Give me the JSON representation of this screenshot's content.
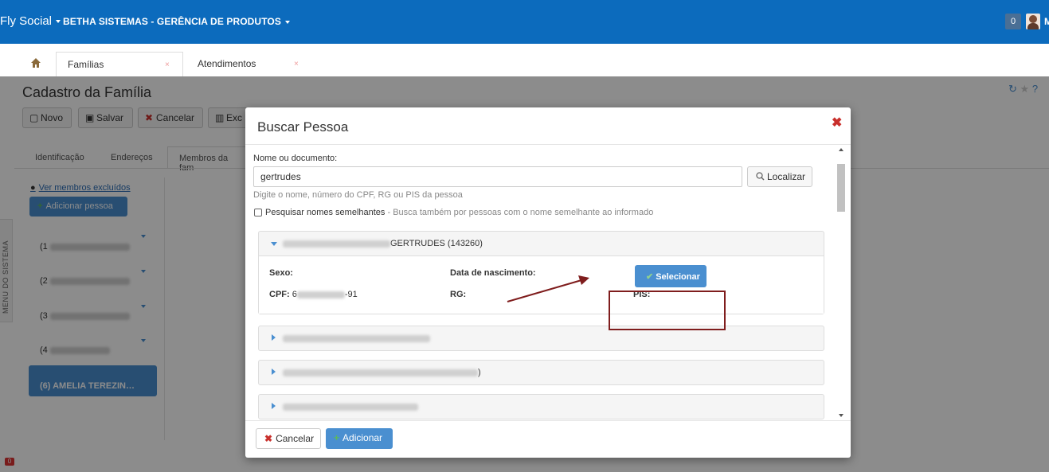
{
  "header": {
    "brand": "Fly Social",
    "company": "BETHA SISTEMAS - GERÊNCIA DE PRODUTOS",
    "notifications": "0",
    "user_initial": "M"
  },
  "tabs": [
    {
      "label": "Famílias",
      "close": "×"
    },
    {
      "label": "Atendimentos",
      "close": "×"
    }
  ],
  "page": {
    "title": "Cadastro da Família",
    "toolbar": {
      "novo": "Novo",
      "salvar": "Salvar",
      "cancelar": "Cancelar",
      "excluir": "Exc"
    },
    "form_tabs": [
      "Identificação",
      "Endereços",
      "Membros da fam"
    ],
    "excluded_link": "Ver membros excluídos",
    "add_person": "Adicionar pessoa",
    "members": [
      "(1",
      "(2",
      "(3",
      "(4"
    ],
    "active_member": "(6) AMELIA TEREZIN…",
    "side_menu": "MENU DO SISTEMA"
  },
  "modal": {
    "title": "Buscar Pessoa",
    "close": "✖",
    "name_label": "Nome ou documento:",
    "search_value": "gertrudes",
    "search_button": "Localizar",
    "hint": "Digite o nome, número do CPF, RG ou PIS da pessoa",
    "similar_label": "Pesquisar nomes semelhantes",
    "similar_desc": "- Busca também por pessoas com o nome semelhante ao informado",
    "result": {
      "title": "GERTRUDES (143260)",
      "sexo_label": "Sexo:",
      "nascimento_label": "Data de nascimento:",
      "cpf_label": "CPF:",
      "cpf_start": "6",
      "cpf_end": "-91",
      "rg_label": "RG:",
      "pis_label": "PIS:",
      "select_button": "Selecionar"
    },
    "other_results": [
      "",
      ")",
      ""
    ],
    "cancel_button": "Cancelar",
    "add_button": "Adicionar"
  }
}
